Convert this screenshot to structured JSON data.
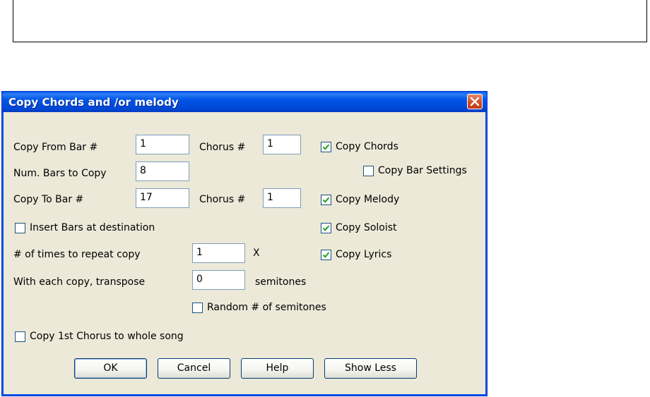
{
  "dialog": {
    "title": "Copy Chords and /or melody",
    "labels": {
      "copy_from_bar": "Copy From Bar #",
      "chorus_1": "Chorus #",
      "num_bars": "Num. Bars to Copy",
      "copy_to_bar": "Copy To Bar #",
      "chorus_2": "Chorus #",
      "repeat": "# of times to repeat copy",
      "repeat_suffix": "X",
      "transpose": "With each copy, transpose",
      "semitones": "semitones"
    },
    "fields": {
      "copy_from_bar": "1",
      "chorus_from": "1",
      "num_bars": "8",
      "copy_to_bar": "17",
      "chorus_to": "1",
      "repeat_times": "1",
      "transpose": "0"
    },
    "checkboxes": {
      "copy_chords": {
        "label": "Copy Chords",
        "checked": true
      },
      "copy_bar_settings": {
        "label": "Copy Bar Settings",
        "checked": false
      },
      "copy_melody": {
        "label": "Copy Melody",
        "checked": true
      },
      "copy_soloist": {
        "label": "Copy Soloist",
        "checked": true
      },
      "copy_lyrics": {
        "label": "Copy Lyrics",
        "checked": true
      },
      "insert_bars": {
        "label": "Insert Bars at destination",
        "checked": false
      },
      "random_semitones": {
        "label": "Random # of semitones",
        "checked": false
      },
      "copy_first_chorus": {
        "label": "Copy 1st Chorus to whole song",
        "checked": false
      }
    },
    "buttons": {
      "ok": "OK",
      "cancel": "Cancel",
      "help": "Help",
      "show_less": "Show Less"
    }
  }
}
